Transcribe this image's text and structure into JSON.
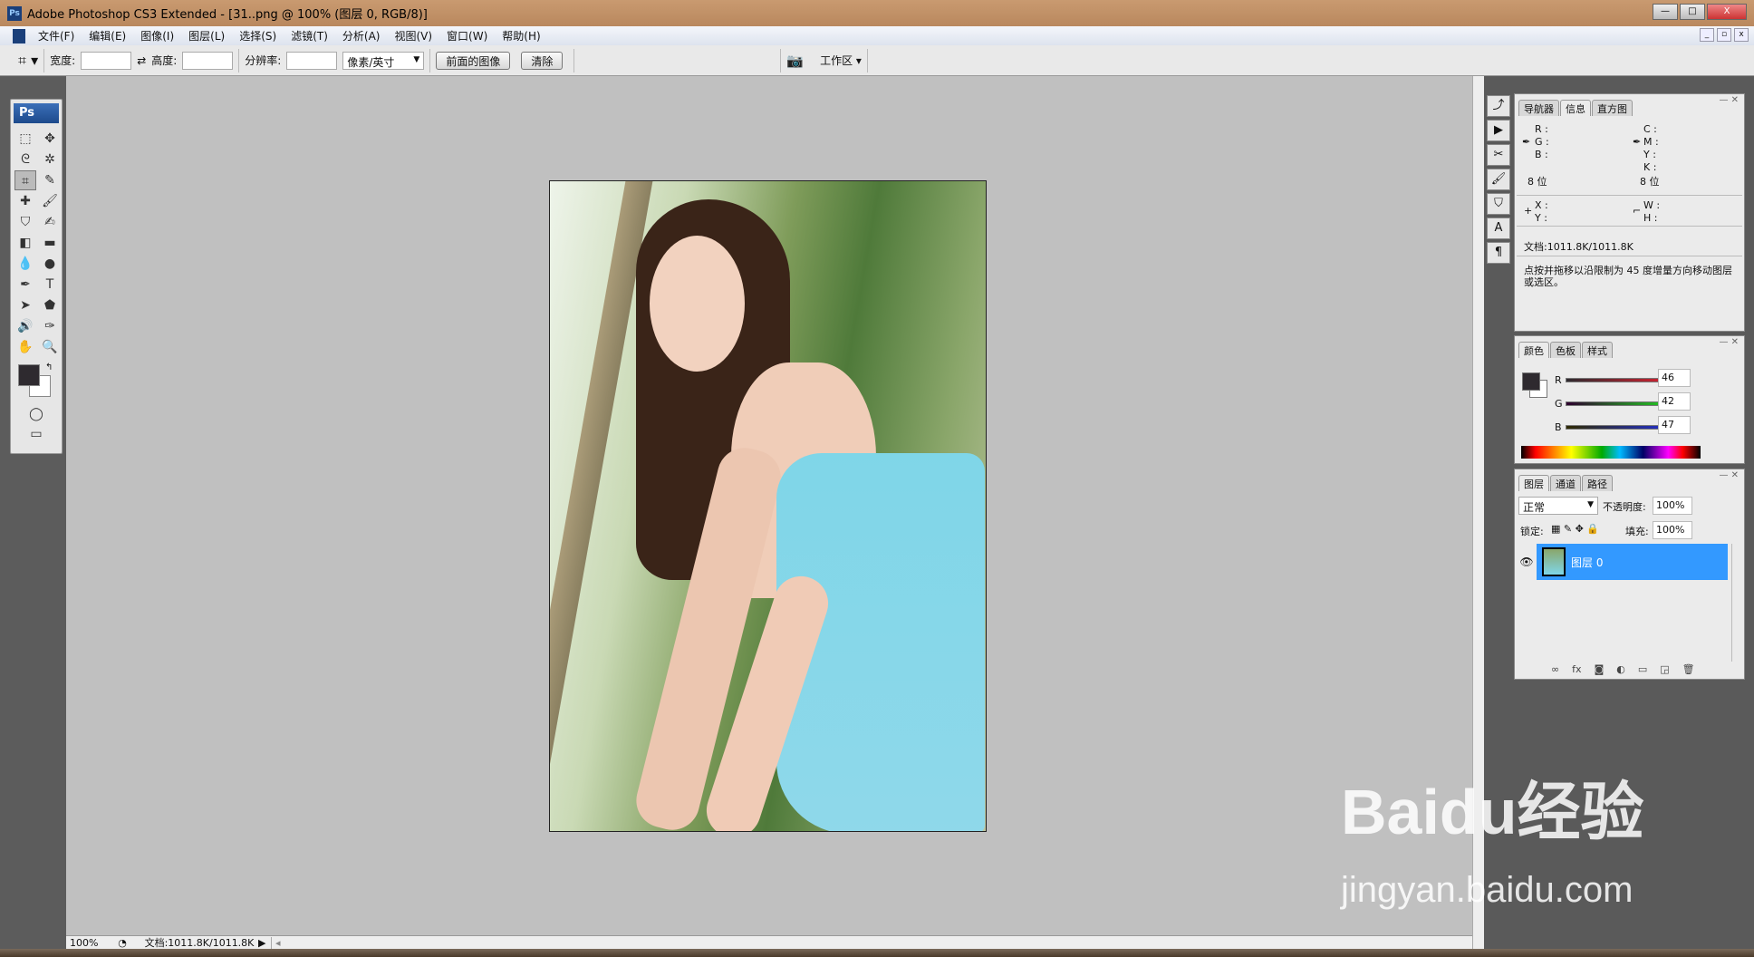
{
  "window": {
    "title": "Adobe Photoshop CS3 Extended - [31..png @ 100% (图层 0, RGB/8)]",
    "minimize": "—",
    "maximize": "□",
    "close": "X"
  },
  "menu": [
    "文件(F)",
    "编辑(E)",
    "图像(I)",
    "图层(L)",
    "选择(S)",
    "滤镜(T)",
    "分析(A)",
    "视图(V)",
    "窗口(W)",
    "帮助(H)"
  ],
  "options": {
    "width_label": "宽度:",
    "width_value": "",
    "height_label": "高度:",
    "height_value": "",
    "resolution_label": "分辨率:",
    "resolution_value": "",
    "unit": "像素/英寸",
    "front_image": "前面的图像",
    "clear": "清除",
    "workspace": "工作区 ▾"
  },
  "toolbox": {
    "logo": "Ps"
  },
  "info_panel": {
    "tabs": [
      "导航器",
      "信息",
      "直方图"
    ],
    "rgb": [
      "R :",
      "G :",
      "B :"
    ],
    "cmyk": [
      "C :",
      "M :",
      "Y :",
      "K :"
    ],
    "bits_left": "8 位",
    "bits_right": "8 位",
    "xy": [
      "X :",
      "Y :"
    ],
    "wh": [
      "W :",
      "H :"
    ],
    "doc": "文档:1011.8K/1011.8K",
    "hint": "点按并拖移以沿限制为 45 度增量方向移动图层或选区。"
  },
  "color_panel": {
    "tabs": [
      "颜色",
      "色板",
      "样式"
    ],
    "channels": [
      {
        "label": "R",
        "value": "46"
      },
      {
        "label": "G",
        "value": "42"
      },
      {
        "label": "B",
        "value": "47"
      }
    ],
    "foreground": "#2e2a2f",
    "background": "#ffffff"
  },
  "layers_panel": {
    "tabs": [
      "图层",
      "通道",
      "路径"
    ],
    "blend_mode": "正常",
    "opacity_label": "不透明度:",
    "opacity": "100%",
    "lock_label": "锁定:",
    "fill_label": "填充:",
    "fill": "100%",
    "layers": [
      {
        "name": "图层 0",
        "visible": true,
        "selected": true
      }
    ]
  },
  "status": {
    "zoom": "100%",
    "doc": "文档:1011.8K/1011.8K"
  },
  "watermark": {
    "line1": "Baidu经验",
    "line2": "jingyan.baidu.com"
  }
}
